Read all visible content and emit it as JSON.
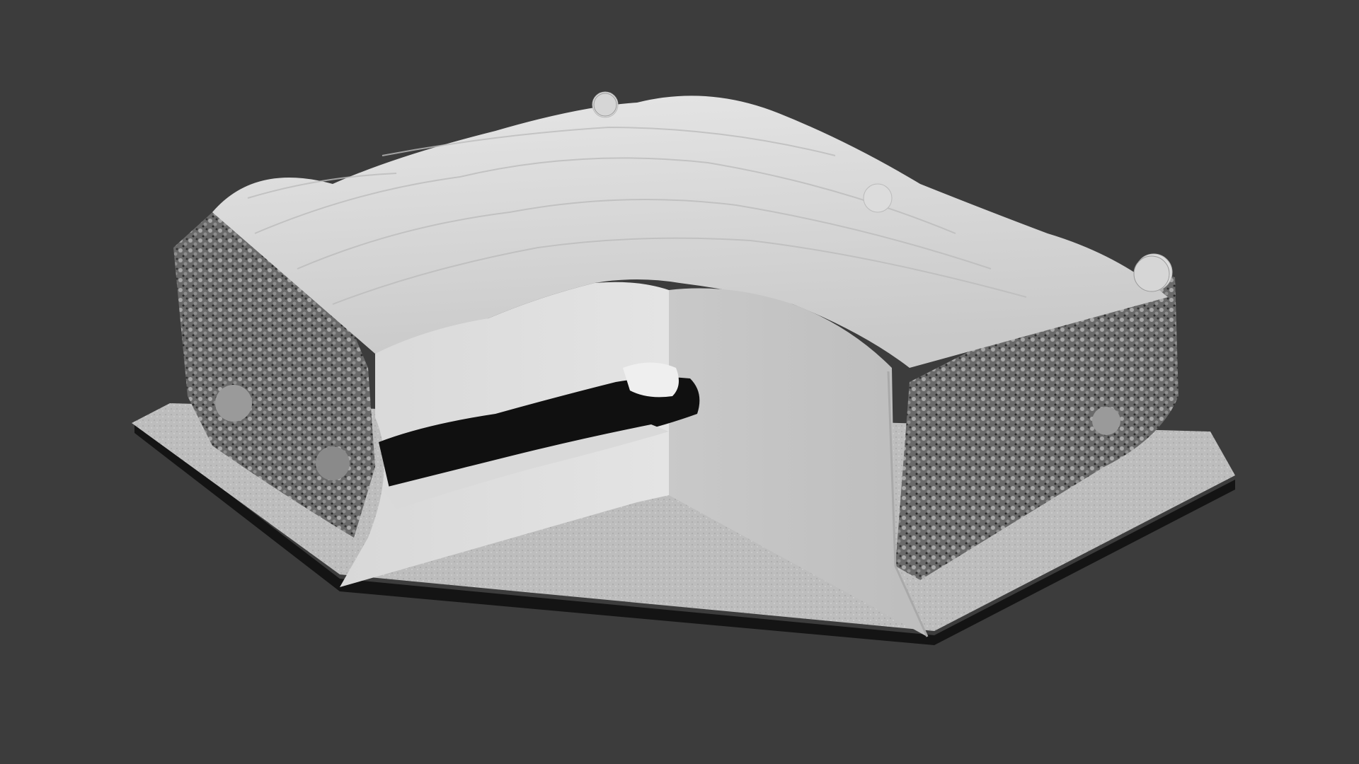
{
  "scene": {
    "subject": "3d-render-cutaway-block",
    "background_color": "#3c3c3c",
    "surface_color": "#d2d2d2",
    "cut_face_color": "#cfcfcf",
    "cavity_color": "#101010",
    "base_plate_color": "#b9b9b9",
    "base_edge_color": "#141414"
  }
}
